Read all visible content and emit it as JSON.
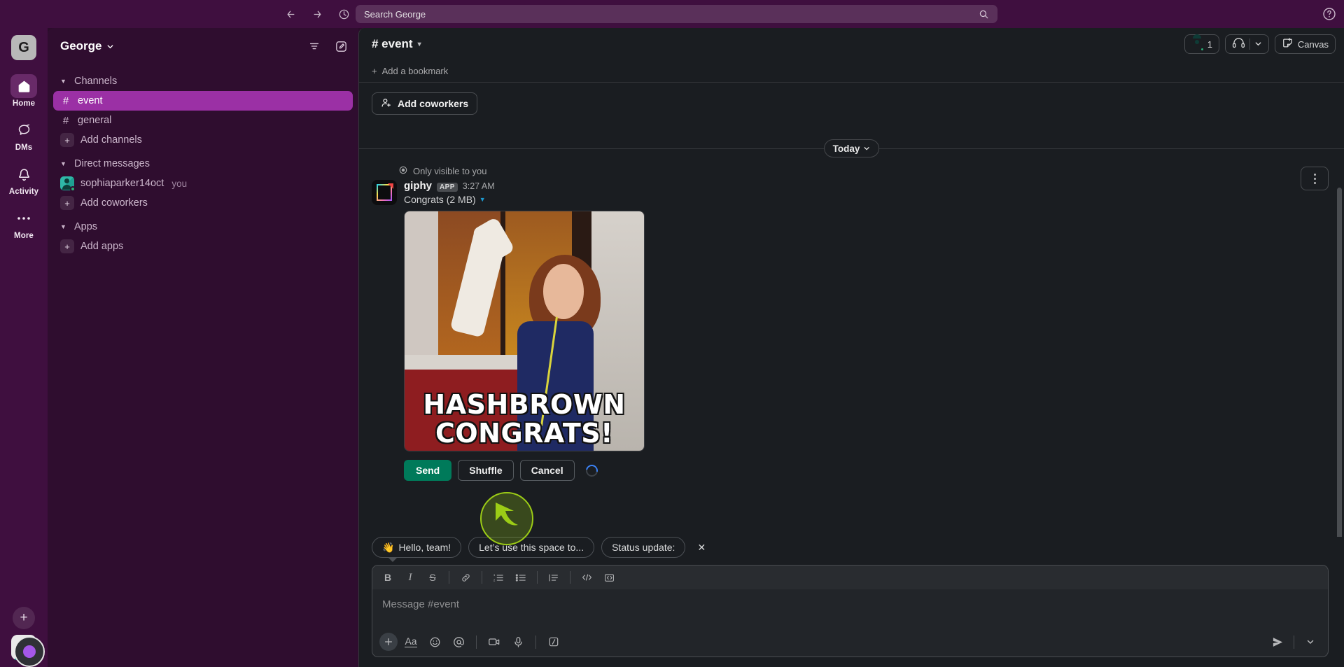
{
  "topbar": {
    "back_icon": "arrow-left-icon",
    "forward_icon": "arrow-right-icon",
    "history_icon": "clock-icon",
    "search_placeholder": "Search George",
    "search_value": "Search George",
    "search_icon": "search-icon",
    "help_icon": "help-circle-icon"
  },
  "rail": {
    "workspace_initial": "G",
    "items": [
      {
        "label": "Home",
        "icon": "home-icon",
        "active": true
      },
      {
        "label": "DMs",
        "icon": "dm-icon",
        "active": false
      },
      {
        "label": "Activity",
        "icon": "bell-icon",
        "active": false
      },
      {
        "label": "More",
        "icon": "ellipsis-icon",
        "active": false
      }
    ],
    "new_button_label": "+",
    "avatar_name": "user-avatar"
  },
  "sidebar": {
    "workspace_name": "George",
    "filter_icon": "filter-icon",
    "compose_icon": "compose-icon",
    "sections": [
      {
        "title": "Channels",
        "expanded": true,
        "items": [
          {
            "label": "event",
            "type": "channel",
            "active": true
          },
          {
            "label": "general",
            "type": "channel",
            "active": false
          },
          {
            "label": "Add channels",
            "type": "add",
            "active": false
          }
        ]
      },
      {
        "title": "Direct messages",
        "expanded": true,
        "items": [
          {
            "label": "sophiaparker14oct",
            "type": "dm",
            "suffix": "you",
            "active": false
          },
          {
            "label": "Add coworkers",
            "type": "add",
            "active": false
          }
        ]
      },
      {
        "title": "Apps",
        "expanded": true,
        "items": [
          {
            "label": "Add apps",
            "type": "add",
            "active": false
          }
        ]
      }
    ]
  },
  "channel": {
    "name": "# event",
    "members_count": "1",
    "huddle_icon": "headphones-icon",
    "canvas_label": "Canvas",
    "bookmark_label": "Add a bookmark",
    "add_coworkers_label": "Add coworkers",
    "day_divider": "Today"
  },
  "message": {
    "ephemeral_note": "Only visible to you",
    "author": "giphy",
    "app_badge": "APP",
    "time": "3:27 AM",
    "file_title": "Congrats (2 MB)",
    "gif_line1": "HASHBROWN",
    "gif_line2": "CONGRATS!",
    "actions": {
      "send": "Send",
      "shuffle": "Shuffle",
      "cancel": "Cancel"
    },
    "more_actions_icon": "kebab-menu-icon"
  },
  "suggestions": {
    "chips": [
      {
        "emoji": "👋",
        "label": "Hello, team!"
      },
      {
        "emoji": "",
        "label": "Let’s use this space to..."
      },
      {
        "emoji": "",
        "label": "Status update:"
      }
    ],
    "close_label": "✕"
  },
  "composer": {
    "placeholder": "Message #event",
    "format_buttons": [
      {
        "name": "bold-icon",
        "glyph": "B"
      },
      {
        "name": "italic-icon",
        "glyph": "I"
      },
      {
        "name": "strikethrough-icon",
        "glyph": "S"
      },
      {
        "name": "link-icon",
        "glyph": "🔗"
      },
      {
        "name": "ordered-list-icon",
        "glyph": "1."
      },
      {
        "name": "bulleted-list-icon",
        "glyph": "☰"
      },
      {
        "name": "blockquote-icon",
        "glyph": "❝"
      },
      {
        "name": "code-icon",
        "glyph": "</>"
      },
      {
        "name": "code-block-icon",
        "glyph": "⌨"
      }
    ],
    "action_buttons": [
      {
        "name": "attach-plus-icon",
        "glyph": "+"
      },
      {
        "name": "formatting-aa-icon",
        "glyph": "Aa"
      },
      {
        "name": "emoji-icon",
        "glyph": "☺"
      },
      {
        "name": "mention-icon",
        "glyph": "@"
      },
      {
        "name": "video-clip-icon",
        "glyph": "▶"
      },
      {
        "name": "microphone-icon",
        "glyph": "🎙"
      },
      {
        "name": "slash-command-icon",
        "glyph": "/"
      }
    ],
    "send_icon": "send-icon",
    "send_options_icon": "chevron-down-icon"
  },
  "colors": {
    "brand_purple": "#3f0f3f",
    "sidebar_purple": "#2f0d2f",
    "active_channel": "#9b30a5",
    "main_bg": "#1a1d21",
    "send_green": "#007a5a",
    "cursor_green": "#9ccc16"
  }
}
